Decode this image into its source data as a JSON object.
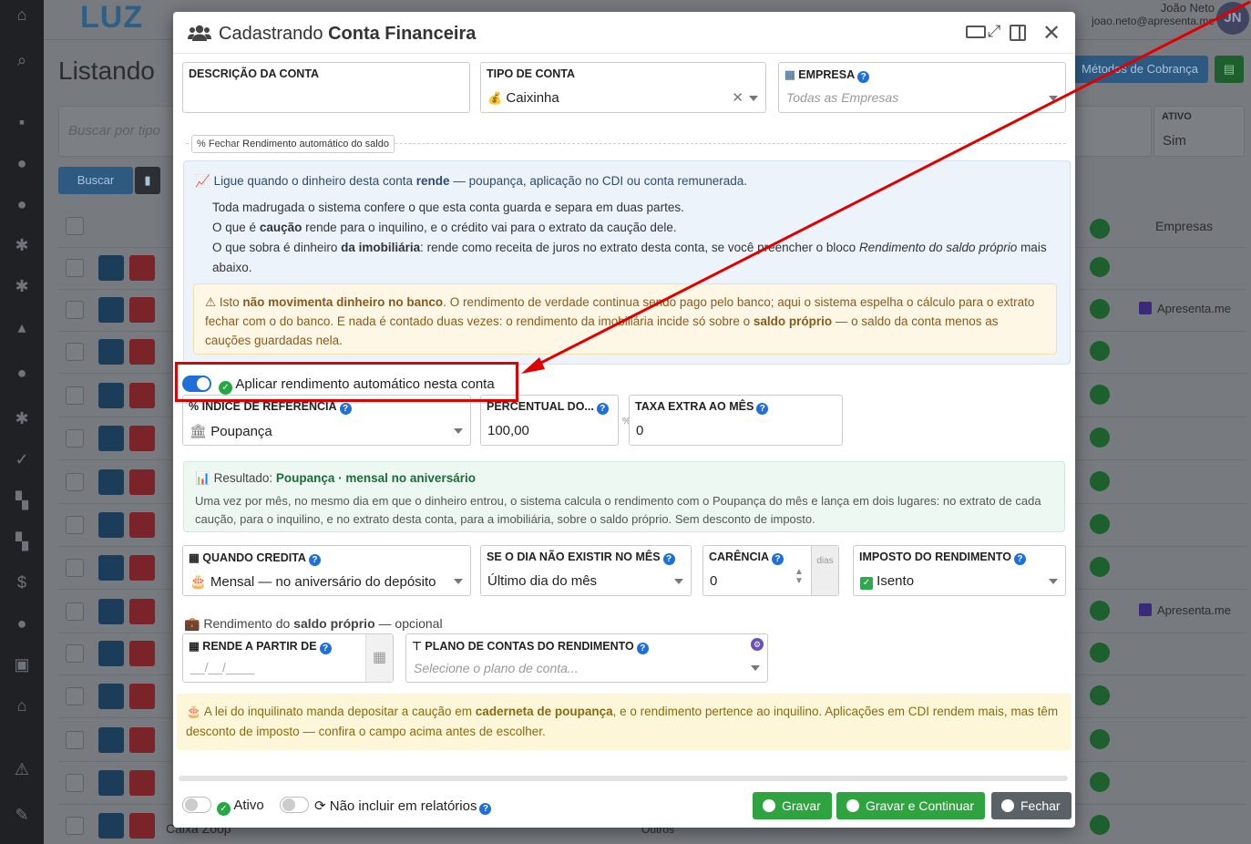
{
  "background": {
    "logo_text": "LUZ",
    "user_name": "João Neto",
    "user_email": "joao.neto@apresenta.me",
    "avatar_initials": "JN",
    "page_title": "Listando",
    "search_placeholder": "Buscar por tipo",
    "search_button": "Buscar",
    "payment_methods_button": "Métodos de Cobrança",
    "filter_active_label": "ATIVO",
    "filter_active_value": "Sim",
    "col_empresas": "Empresas",
    "row_company": "Apresenta.me",
    "row_last_name": "Caixa Zoop",
    "row_last_other": "Outros"
  },
  "modal": {
    "title_prefix": "Cadastrando",
    "title_bold": "Conta Financeira",
    "description_label": "DESCRIÇÃO DA CONTA",
    "description_value": "",
    "account_type_label": "TIPO DE CONTA",
    "account_type_value": "Caixinha",
    "company_label": "EMPRESA",
    "company_placeholder": "Todas as Empresas",
    "section_toggle_prefix": "Fechar",
    "section_toggle_label": "Rendimento automático do saldo",
    "info_title_prefix": "Ligue quando o dinheiro desta conta",
    "info_title_bold": "rende",
    "info_title_suffix": "— poupança, aplicação no CDI ou conta remunerada.",
    "info_line1": "Toda madrugada o sistema confere o que esta conta guarda e separa em duas partes.",
    "info_line2_a": "O que é",
    "info_line2_b": "caução",
    "info_line2_c": "rende para o inquilino, e o crédito vai para o extrato da caução dele.",
    "info_line3_a": "O que sobra é dinheiro",
    "info_line3_b": "da imobiliária",
    "info_line3_c": ": rende como receita de juros no extrato desta conta, se você preencher o bloco",
    "info_line3_d": "Rendimento do saldo próprio",
    "info_line3_e": "mais abaixo.",
    "warn_a": "Isto",
    "warn_b": "não movimenta dinheiro no banco",
    "warn_c": ". O rendimento de verdade continua sendo pago pelo banco; aqui o sistema espelha o cálculo para o extrato fechar com o do banco. E nada é contado duas vezes: o rendimento da imobiliária incide só sobre o",
    "warn_d": "saldo próprio",
    "warn_e": "— o saldo da conta menos as cauções guardadas nela.",
    "apply_label": "Aplicar rendimento automático nesta conta",
    "index_label": "ÍNDICE DE REFERÊNCIA",
    "index_value": "Poupança",
    "percent_label": "PERCENTUAL DO...",
    "percent_value": "100,00",
    "percent_unit": "%",
    "extra_rate_label": "TAXA EXTRA AO MÊS",
    "extra_rate_value": "0",
    "result_prefix": "Resultado:",
    "result_bold": "Poupança · mensal no aniversário",
    "result_text": "Uma vez por mês, no mesmo dia em que o dinheiro entrou, o sistema calcula o rendimento com o Poupança do mês e lança em dois lugares: no extrato de cada caução, para o inquilino, e no extrato desta conta, para a imobiliária, sobre o saldo próprio. Sem desconto de imposto.",
    "credit_label": "QUANDO CREDITA",
    "credit_value": "Mensal — no aniversário do depósito",
    "missing_day_label": "SE O DIA NÃO EXISTIR NO MÊS",
    "missing_day_value": "Último dia do mês",
    "grace_label": "CARÊNCIA",
    "grace_value": "0",
    "grace_unit": "dias",
    "tax_label": "IMPOSTO DO RENDIMENTO",
    "tax_value": "Isento",
    "own_balance_a": "Rendimento do",
    "own_balance_b": "saldo próprio",
    "own_balance_c": "— opcional",
    "start_label": "RENDE A PARTIR DE",
    "start_placeholder": "__/__/____",
    "plan_label": "PLANO DE CONTAS DO RENDIMENTO",
    "plan_placeholder": "Selecione o plano de conta...",
    "tip_a": "A lei do inquilinato manda depositar a caução em",
    "tip_b": "caderneta de poupança",
    "tip_c": ", e o rendimento pertence ao inquilino. Aplicações em CDI rendem mais, mas têm desconto de imposto — confira o campo acima antes de escolher.",
    "active_label": "Ativo",
    "exclude_reports_label": "Não incluir em relatórios",
    "save_label": "Gravar",
    "save_continue_label": "Gravar e Continuar",
    "close_label": "Fechar"
  },
  "colors": {
    "primary": "#1e6fd9",
    "success": "#26a744",
    "secondary": "#5a6268",
    "annotation": "#e00000"
  }
}
